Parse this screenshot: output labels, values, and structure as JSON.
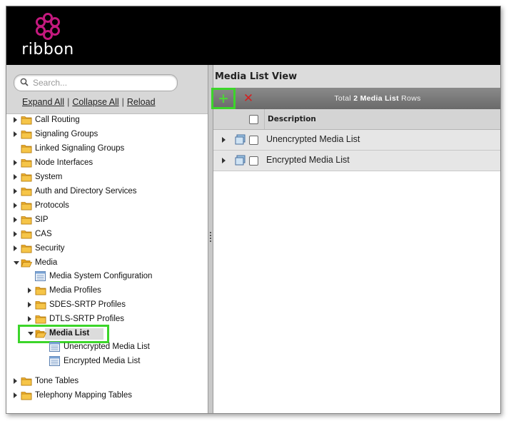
{
  "header": {
    "logo_text": "ribbon"
  },
  "left_panel": {
    "search": {
      "placeholder": "Search...",
      "value": ""
    },
    "links": {
      "expand_all": "Expand All",
      "collapse_all": "Collapse All",
      "reload": "Reload",
      "separator": "|"
    },
    "tree": [
      {
        "label": "Call Routing",
        "type": "folder",
        "expandable": true,
        "expanded": false
      },
      {
        "label": "Signaling Groups",
        "type": "folder",
        "expandable": true,
        "expanded": false
      },
      {
        "label": "Linked Signaling Groups",
        "type": "folder",
        "expandable": false,
        "expanded": false
      },
      {
        "label": "Node Interfaces",
        "type": "folder",
        "expandable": true,
        "expanded": false
      },
      {
        "label": "System",
        "type": "folder",
        "expandable": true,
        "expanded": false
      },
      {
        "label": "Auth and Directory Services",
        "type": "folder",
        "expandable": true,
        "expanded": false
      },
      {
        "label": "Protocols",
        "type": "folder",
        "expandable": true,
        "expanded": false
      },
      {
        "label": "SIP",
        "type": "folder",
        "expandable": true,
        "expanded": false
      },
      {
        "label": "CAS",
        "type": "folder",
        "expandable": true,
        "expanded": false
      },
      {
        "label": "Security",
        "type": "folder",
        "expandable": true,
        "expanded": false
      },
      {
        "label": "Media",
        "type": "folder",
        "expandable": true,
        "expanded": true
      },
      {
        "label": "Media System Configuration",
        "type": "doc"
      },
      {
        "label": "Media Profiles",
        "type": "folder",
        "expandable": true,
        "expanded": false
      },
      {
        "label": "SDES-SRTP Profiles",
        "type": "folder",
        "expandable": true,
        "expanded": false
      },
      {
        "label": "DTLS-SRTP Profiles",
        "type": "folder",
        "expandable": true,
        "expanded": false
      },
      {
        "label": "Media List",
        "type": "folder",
        "expandable": true,
        "expanded": true,
        "selected": true
      },
      {
        "label": "Unencrypted Media List",
        "type": "doc"
      },
      {
        "label": "Encrypted Media List",
        "type": "doc"
      },
      {
        "label": "Tone Tables",
        "type": "folder",
        "expandable": true,
        "expanded": false
      },
      {
        "label": "Telephony Mapping Tables",
        "type": "folder",
        "expandable": true,
        "expanded": false
      }
    ]
  },
  "main": {
    "title": "Media List View",
    "toolbar": {
      "add_icon": "+",
      "delete_icon": "✕",
      "total_prefix": "Total",
      "total_count": "2",
      "total_entity": "Media List",
      "total_suffix": "Rows"
    },
    "columns": {
      "description": "Description"
    },
    "rows": [
      {
        "description": "Unencrypted Media List"
      },
      {
        "description": "Encrypted Media List"
      }
    ]
  },
  "colors": {
    "header_bg": "#000000",
    "highlight": "#3cd52a",
    "delete": "#d42020",
    "logo_magenta": "#c4197e"
  }
}
